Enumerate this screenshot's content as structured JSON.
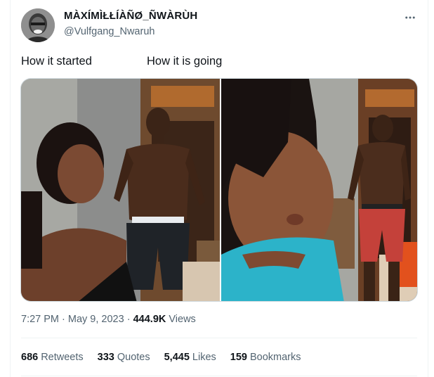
{
  "author": {
    "display_name": "MÀXÍMÌŁŁÍÀÑØ_ÑWÀRÙH",
    "handle": "@Vulfgang_Nwaruh"
  },
  "tweet": {
    "text_left": "How it started",
    "text_right": "How it is going"
  },
  "media": {
    "photos": [
      "photo-how-it-started",
      "photo-how-it-is-going"
    ]
  },
  "meta": {
    "time": "7:27 PM",
    "separator": " · ",
    "date": "May 9, 2023",
    "views_count": "444.9K",
    "views_label": " Views"
  },
  "stats": [
    {
      "num": "686",
      "label": "Retweets"
    },
    {
      "num": "333",
      "label": "Quotes"
    },
    {
      "num": "5,445",
      "label": "Likes"
    },
    {
      "num": "159",
      "label": "Bookmarks"
    }
  ],
  "colors": {
    "primary_text": "#0f1419",
    "secondary_text": "#536471",
    "divider": "#eff3f4"
  },
  "icons": {
    "more": "more-horizontal-icon"
  }
}
